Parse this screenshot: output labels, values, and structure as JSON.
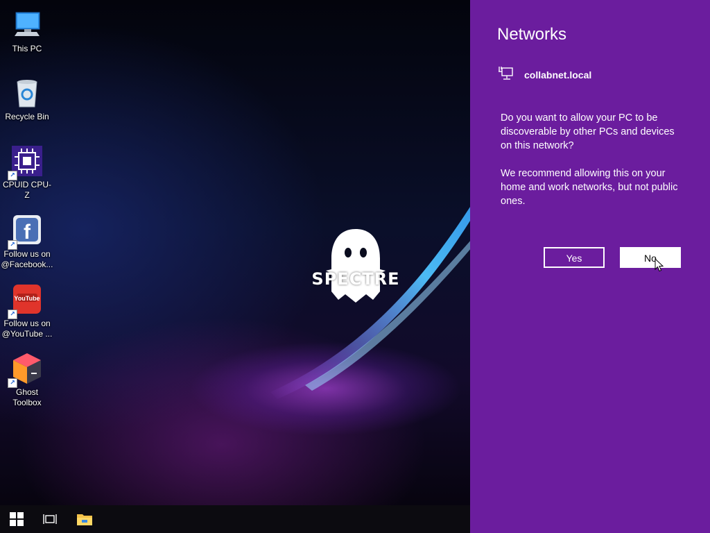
{
  "desktop": {
    "icons": [
      {
        "label": "This PC",
        "icon": "this-pc-icon"
      },
      {
        "label": "Recycle Bin",
        "icon": "recycle-bin-icon"
      },
      {
        "label": "CPUID CPU-Z",
        "icon": "cpu-z-icon"
      },
      {
        "label": "Follow us on @Facebook...",
        "icon": "facebook-icon"
      },
      {
        "label": "Follow us on @YouTube ...",
        "icon": "youtube-icon"
      },
      {
        "label": "Ghost Toolbox",
        "icon": "ghost-toolbox-icon"
      }
    ],
    "logo_text": "SPECTRE",
    "youtube_badge": "YouTube",
    "facebook_badge": "f"
  },
  "networks_panel": {
    "title": "Networks",
    "network_name": "collabnet.local",
    "network_icon": "ethernet-icon",
    "question": "Do you want to allow your PC to be discoverable by other PCs and devices on this network?",
    "recommendation": "We recommend allowing this on your home and work networks, but not public ones.",
    "yes_label": "Yes",
    "no_label": "No",
    "background_color": "#6b1d9e"
  },
  "taskbar": {
    "items": [
      "start-icon",
      "task-view-icon",
      "file-explorer-icon"
    ]
  }
}
